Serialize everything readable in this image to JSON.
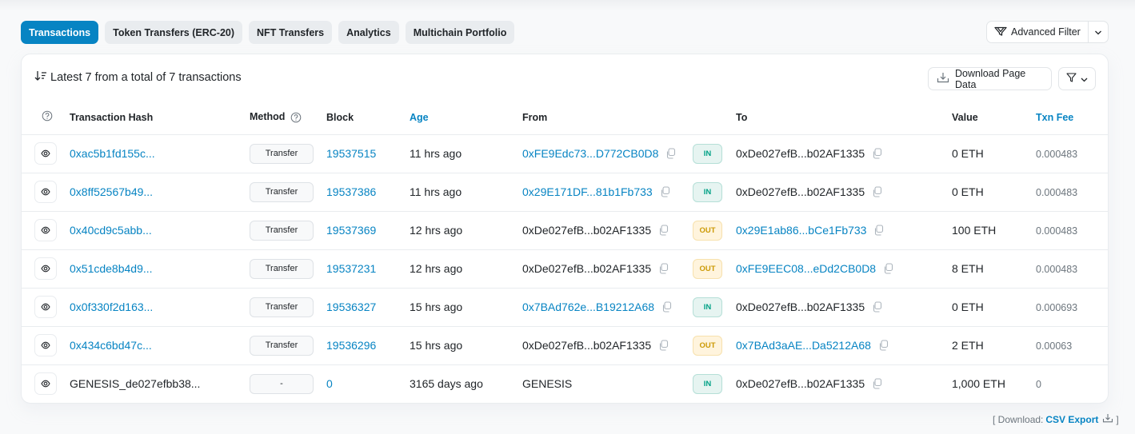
{
  "tabs": [
    {
      "label": "Transactions",
      "active": true
    },
    {
      "label": "Token Transfers (ERC-20)",
      "active": false
    },
    {
      "label": "NFT Transfers",
      "active": false
    },
    {
      "label": "Analytics",
      "active": false
    },
    {
      "label": "Multichain Portfolio",
      "active": false
    }
  ],
  "advanced_filter": {
    "label": "Advanced Filter"
  },
  "card": {
    "summary": "Latest 7 from a total of 7 transactions",
    "download_label": "Download Page Data"
  },
  "columns": {
    "hash": "Transaction Hash",
    "method": "Method",
    "block": "Block",
    "age": "Age",
    "from": "From",
    "to": "To",
    "value": "Value",
    "fee": "Txn Fee"
  },
  "rows": [
    {
      "hash": "0xac5b1fd155c...",
      "method": "Transfer",
      "block": "19537515",
      "age": "11 hrs ago",
      "from": "0xFE9Edc73...D772CB0D8",
      "from_link": true,
      "dir": "IN",
      "to": "0xDe027efB...b02AF1335",
      "to_link": false,
      "value": "0 ETH",
      "fee": "0.000483"
    },
    {
      "hash": "0x8ff52567b49...",
      "method": "Transfer",
      "block": "19537386",
      "age": "11 hrs ago",
      "from": "0x29E171DF...81b1Fb733",
      "from_link": true,
      "dir": "IN",
      "to": "0xDe027efB...b02AF1335",
      "to_link": false,
      "value": "0 ETH",
      "fee": "0.000483"
    },
    {
      "hash": "0x40cd9c5abb...",
      "method": "Transfer",
      "block": "19537369",
      "age": "12 hrs ago",
      "from": "0xDe027efB...b02AF1335",
      "from_link": false,
      "dir": "OUT",
      "to": "0x29E1ab86...bCe1Fb733",
      "to_link": true,
      "value": "100 ETH",
      "fee": "0.000483"
    },
    {
      "hash": "0x51cde8b4d9...",
      "method": "Transfer",
      "block": "19537231",
      "age": "12 hrs ago",
      "from": "0xDe027efB...b02AF1335",
      "from_link": false,
      "dir": "OUT",
      "to": "0xFE9EEC08...eDd2CB0D8",
      "to_link": true,
      "value": "8 ETH",
      "fee": "0.000483"
    },
    {
      "hash": "0x0f330f2d163...",
      "method": "Transfer",
      "block": "19536327",
      "age": "15 hrs ago",
      "from": "0x7BAd762e...B19212A68",
      "from_link": true,
      "dir": "IN",
      "to": "0xDe027efB...b02AF1335",
      "to_link": false,
      "value": "0 ETH",
      "fee": "0.000693"
    },
    {
      "hash": "0x434c6bd47c...",
      "method": "Transfer",
      "block": "19536296",
      "age": "15 hrs ago",
      "from": "0xDe027efB...b02AF1335",
      "from_link": false,
      "dir": "OUT",
      "to": "0x7BAd3aAE...Da5212A68",
      "to_link": true,
      "value": "2 ETH",
      "fee": "0.00063"
    },
    {
      "hash": "GENESIS_de027efbb38...",
      "hash_link": false,
      "method": "-",
      "block": "0",
      "age": "3165 days ago",
      "from": "GENESIS",
      "from_link": false,
      "from_copy": false,
      "dir": "IN",
      "to": "0xDe027efB...b02AF1335",
      "to_link": false,
      "value": "1,000 ETH",
      "fee": "0"
    }
  ],
  "footer": {
    "prefix": "[ Download: ",
    "link": "CSV Export",
    "suffix": "]"
  },
  "colors": {
    "accent": "#0784c3",
    "in_badge": "#00a186",
    "out_badge": "#cc9a06"
  }
}
